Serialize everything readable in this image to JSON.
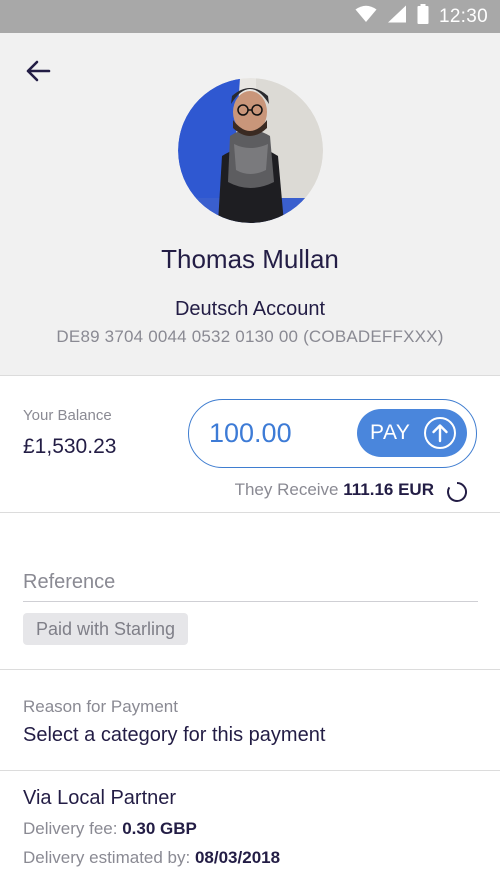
{
  "status_bar": {
    "time": "12:30",
    "icons": [
      "wifi-icon",
      "cell-signal-icon",
      "battery-icon"
    ]
  },
  "header": {
    "back_icon": "arrow-left-icon",
    "name": "Thomas Mullan",
    "account_name": "Deutsch Account",
    "account_details": "DE89 3704 0044 0532 0130 00 (COBADEFFXXX)"
  },
  "balance": {
    "label": "Your Balance",
    "value": "£1,530.23",
    "amount": "100.00",
    "pay_label": "PAY",
    "receive_label": "They Receive",
    "receive_value": "111.16 EUR"
  },
  "reference": {
    "placeholder": "Reference",
    "chip": "Paid with Starling"
  },
  "reason": {
    "label": "Reason for Payment",
    "value": "Select a category for this payment"
  },
  "partner": {
    "title": "Via Local Partner",
    "fee_label": "Delivery fee:",
    "fee_value": "0.30 GBP",
    "est_label": "Delivery estimated by:",
    "est_value": "08/03/2018"
  },
  "colors": {
    "accent": "#4a86dc",
    "text": "#231d45",
    "muted": "#8a8a93",
    "header_bg": "#f1f1f1",
    "status_bar": "#a8a8a8"
  }
}
